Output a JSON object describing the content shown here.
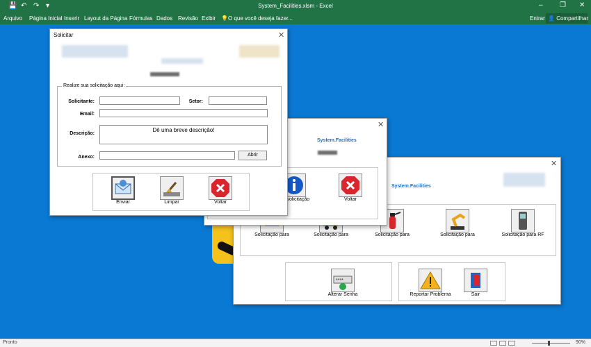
{
  "titlebar": {
    "title": "System_Facilities.xlsm - Excel",
    "minimize": "–",
    "restore": "❐",
    "close": "✕",
    "qa_save": "💾",
    "qa_undo": "↶",
    "qa_redo": "↷",
    "qa_more": "▾"
  },
  "ribbon": {
    "tabs": [
      "Arquivo",
      "Página Inicial",
      "Inserir",
      "Layout da Página",
      "Fórmulas",
      "Dados",
      "Revisão",
      "Exibir"
    ],
    "tell_me": "O que você deseja fazer...",
    "signin": "Entrar",
    "share": "Compartilhar"
  },
  "status": {
    "ready": "Pronto",
    "zoom": "90%"
  },
  "solicitar": {
    "title": "Solicitar",
    "frame_legend": "Realize sua solicitação aqui:",
    "labels": {
      "solicitante": "Solicitante:",
      "setor": "Setor:",
      "email": "Email:",
      "descricao": "Descrição:",
      "anexo": "Anexo:"
    },
    "values": {
      "solicitante": "",
      "setor": "",
      "email": "",
      "descricao": "Dê uma breve descrição!",
      "anexo": ""
    },
    "abrir": "Abrir",
    "actions": [
      "Enviar",
      "Limpar",
      "Voltar"
    ]
  },
  "mid_dialog": {
    "brand": "System.Facilities",
    "actions": [
      "ltar solicitação",
      "Voltar"
    ]
  },
  "back_dialog": {
    "brand": "System.Facilities",
    "tiles": [
      "Solicitação para",
      "Solicitação para",
      "Solicitação para",
      "Solicitação para",
      "Solicitação para RF"
    ],
    "lower_left": [
      "Alterar Senha"
    ],
    "lower_right": [
      "Reportar Problema",
      "Sair"
    ]
  },
  "colors": {
    "excel_green": "#217346",
    "desktop_blue": "#0a79d4",
    "brand_blue": "#1f6fbf",
    "stop_red": "#d8262c",
    "info_blue": "#1559c8"
  }
}
